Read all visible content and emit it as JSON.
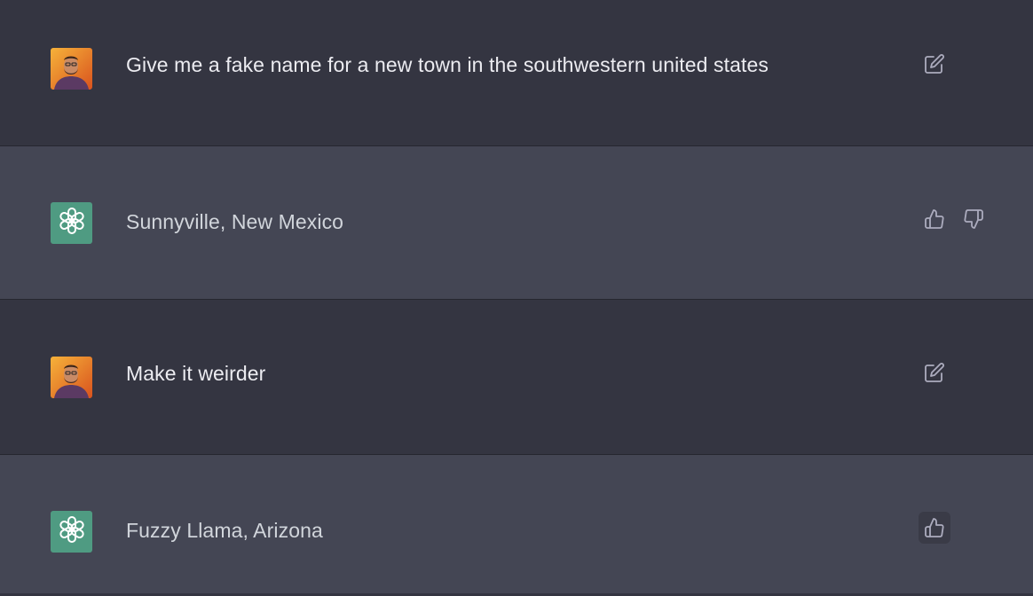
{
  "conversation": {
    "messages": [
      {
        "role": "user",
        "text": "Give me a fake name for a new town in the southwestern united states",
        "actions": [
          "edit-icon"
        ]
      },
      {
        "role": "assistant",
        "text": "Sunnyville, New Mexico",
        "actions": [
          "thumbs-up-icon",
          "thumbs-down-icon"
        ]
      },
      {
        "role": "user",
        "text": "Make it weirder",
        "actions": [
          "edit-icon"
        ]
      },
      {
        "role": "assistant",
        "text": "Fuzzy Llama, Arizona",
        "actions": [
          "thumbs-up-icon"
        ]
      }
    ]
  },
  "colors": {
    "user_row_bg": "#343541",
    "assistant_row_bg": "#444654",
    "assistant_avatar_bg": "#4f9b82",
    "user_text": "#ececf1",
    "assistant_text": "#d1d5db",
    "icon_color": "#acacbe"
  }
}
